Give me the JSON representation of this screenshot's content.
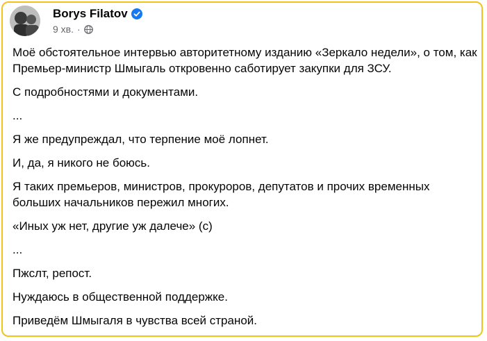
{
  "author": {
    "name": "Borys Filatov",
    "time": "9 хв."
  },
  "icons": {
    "avatar": "avatar-photo",
    "verified": "verified-badge-icon",
    "privacy": "globe-icon"
  },
  "colors": {
    "frame": "#f0c419",
    "verified": "#1877f2",
    "meta": "#65676b"
  },
  "post": {
    "paragraphs": [
      "Моё обстоятельное интервью авторитетному изданию «Зеркало недели», о том, как Премьер-министр Шмыгаль откровенно саботирует закупки для ЗСУ.",
      "С подробностями и документами.",
      "...",
      "Я же предупреждал, что терпение моё лопнет.",
      "И, да, я никого не боюсь.",
      "Я таких премьеров, министров, прокуроров, депутатов и прочих временных больших начальников пережил многих.",
      "«Иных уж нет, другие уж далече» (c)",
      "...",
      "Пжслт, репост.",
      "Нуждаюсь в общественной поддержке.",
      "Приведём Шмыгаля в чувства всей страной."
    ]
  }
}
